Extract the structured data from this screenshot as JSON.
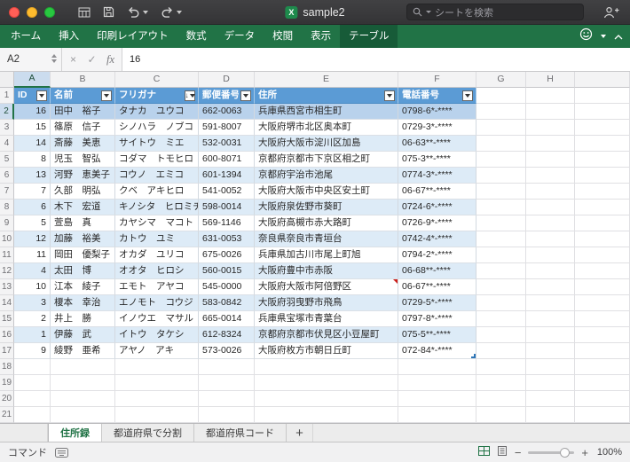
{
  "titlebar": {
    "title": "sample2",
    "search_placeholder": "シートを検索"
  },
  "ribbon": {
    "tabs": [
      {
        "label": "ホーム",
        "active": false
      },
      {
        "label": "挿入",
        "active": false
      },
      {
        "label": "印刷レイアウト",
        "active": false
      },
      {
        "label": "数式",
        "active": false
      },
      {
        "label": "データ",
        "active": false
      },
      {
        "label": "校閲",
        "active": false
      },
      {
        "label": "表示",
        "active": false
      },
      {
        "label": "テーブル",
        "active": true
      }
    ]
  },
  "formula_bar": {
    "name_box": "A2",
    "cancel": "×",
    "enter": "✓",
    "fx": "fx",
    "value": "16"
  },
  "grid": {
    "column_letters": [
      "A",
      "B",
      "C",
      "D",
      "E",
      "F",
      "G",
      "H"
    ],
    "selected_column": "A",
    "selected_row": 2,
    "row_count": 21,
    "table": {
      "headers": [
        {
          "label": "ID",
          "sorted": false
        },
        {
          "label": "名前",
          "sorted": false
        },
        {
          "label": "フリガナ",
          "sorted": true
        },
        {
          "label": "郵便番号",
          "sorted": false
        },
        {
          "label": "住所",
          "sorted": false
        },
        {
          "label": "電話番号",
          "sorted": false
        }
      ],
      "rows": [
        {
          "id": "16",
          "name": "田中　裕子",
          "kana": "タナカ　ユウコ",
          "zip": "662-0063",
          "address": "兵庫県西宮市相生町",
          "phone": "0798-6*-****"
        },
        {
          "id": "15",
          "name": "篠原　信子",
          "kana": "シノハラ　ノブコ",
          "zip": "591-8007",
          "address": "大阪府堺市北区奥本町",
          "phone": "0729-3*-****"
        },
        {
          "id": "14",
          "name": "斎藤　美恵",
          "kana": "サイトウ　ミエ",
          "zip": "532-0031",
          "address": "大阪府大阪市淀川区加島",
          "phone": "06-63**-****"
        },
        {
          "id": "8",
          "name": "児玉　智弘",
          "kana": "コダマ　トモヒロ",
          "zip": "600-8071",
          "address": "京都府京都市下京区相之町",
          "phone": "075-3**-****"
        },
        {
          "id": "13",
          "name": "河野　恵美子",
          "kana": "コウノ　エミコ",
          "zip": "601-1394",
          "address": "京都府宇治市池尾",
          "phone": "0774-3*-****"
        },
        {
          "id": "7",
          "name": "久部　明弘",
          "kana": "クベ　アキヒロ",
          "zip": "541-0052",
          "address": "大阪府大阪市中央区安土町",
          "phone": "06-67**-****"
        },
        {
          "id": "6",
          "name": "木下　宏道",
          "kana": "キノシタ　ヒロミチ",
          "zip": "598-0014",
          "address": "大阪府泉佐野市葵町",
          "phone": "0724-6*-****"
        },
        {
          "id": "5",
          "name": "萱島　真",
          "kana": "カヤシマ　マコト",
          "zip": "569-1146",
          "address": "大阪府高槻市赤大路町",
          "phone": "0726-9*-****"
        },
        {
          "id": "12",
          "name": "加藤　裕美",
          "kana": "カトウ　ユミ",
          "zip": "631-0053",
          "address": "奈良県奈良市青垣台",
          "phone": "0742-4*-****"
        },
        {
          "id": "11",
          "name": "岡田　優梨子",
          "kana": "オカダ　ユリコ",
          "zip": "675-0026",
          "address": "兵庫県加古川市尾上町旭",
          "phone": "0794-2*-****"
        },
        {
          "id": "4",
          "name": "太田　博",
          "kana": "オオタ　ヒロシ",
          "zip": "560-0015",
          "address": "大阪府豊中市赤阪",
          "phone": "06-68**-****"
        },
        {
          "id": "10",
          "name": "江本　綾子",
          "kana": "エモト　アヤコ",
          "zip": "545-0000",
          "address": "大阪府大阪市阿倍野区",
          "phone": "06-67**-****",
          "has_comment": true
        },
        {
          "id": "3",
          "name": "榎本　幸治",
          "kana": "エノモト　コウジ",
          "zip": "583-0842",
          "address": "大阪府羽曳野市飛鳥",
          "phone": "0729-5*-****"
        },
        {
          "id": "2",
          "name": "井上　勝",
          "kana": "イノウエ　マサル",
          "zip": "665-0014",
          "address": "兵庫県宝塚市青葉台",
          "phone": "0797-8*-****"
        },
        {
          "id": "1",
          "name": "伊藤　武",
          "kana": "イトウ　タケシ",
          "zip": "612-8324",
          "address": "京都府京都市伏見区小豆屋町",
          "phone": "075-5**-****"
        },
        {
          "id": "9",
          "name": "綾野　亜希",
          "kana": "アヤノ　アキ",
          "zip": "573-0026",
          "address": "大阪府枚方市朝日丘町",
          "phone": "072-84*-****",
          "has_handle": true
        }
      ]
    }
  },
  "sheet_tabs": {
    "tabs": [
      {
        "label": "住所録",
        "active": true
      },
      {
        "label": "都道府県で分割",
        "active": false
      },
      {
        "label": "都道府県コード",
        "active": false
      }
    ],
    "add_label": "+"
  },
  "status_bar": {
    "left_label": "コマンド",
    "zoom_out": "−",
    "zoom_in": "+",
    "zoom_level": "100%"
  },
  "colors": {
    "ribbon_green": "#217346",
    "table_header_blue": "#5b9bd5",
    "band_blue": "#ddebf7",
    "selection_blue": "#b9d2ec",
    "comment_red": "#cc1f1a"
  }
}
